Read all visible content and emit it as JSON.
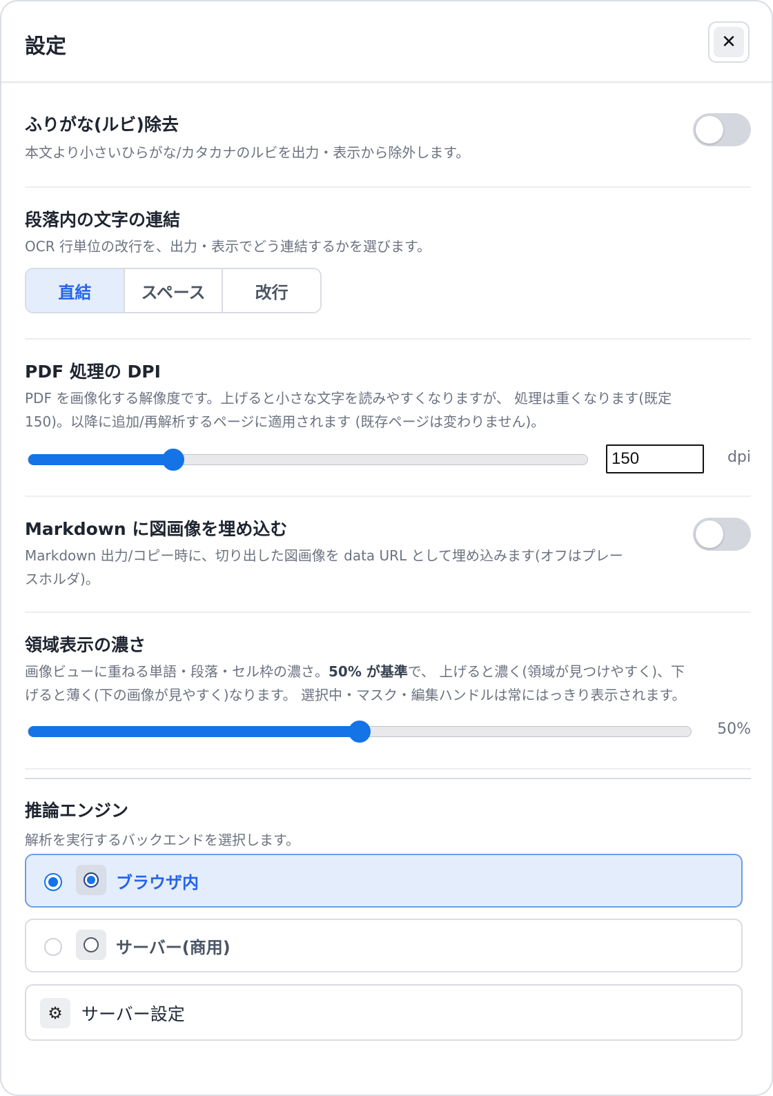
{
  "dialog": {
    "title": "設定",
    "close_glyph": "✕"
  },
  "ruby": {
    "title": "ふりがな(ルビ)除去",
    "description": "本文より小さいひらがな/カタカナのルビを出力・表示から除外します。",
    "enabled": false
  },
  "join": {
    "title": "段落内の文字の連結",
    "description": "OCR 行単位の改行を、出力・表示でどう連結するかを選びます。",
    "options": [
      "直結",
      "スペース",
      "改行"
    ],
    "selected": "直結"
  },
  "dpi": {
    "title": "PDF 処理の DPI",
    "description_line1": "PDF を画像化する解像度です。上げると小さな文字を読みやすくなりますが、 処理は重くなります(既定",
    "description_line2": "150)。以降に追加/再解析するページに適用されます (既存ページは変わりません)。",
    "value": "150",
    "unit": "dpi",
    "slider_fraction": 0.26
  },
  "markdown": {
    "title": "Markdown に図画像を埋め込む",
    "description_line1": "Markdown 出力/コピー時に、切り出した図画像を data URL として埋め込みます(オフはプレー",
    "description_line2": "スホルダ)。",
    "enabled": false
  },
  "opacity": {
    "title": "領域表示の濃さ",
    "description_pre": "画像ビューに重ねる単語・段落・セル枠の濃さ。",
    "description_bold": "50% が基準",
    "description_post": "で、 上げると濃く(領域が見つけやすく)、下",
    "description_line2": "げると薄く(下の画像が見やすく)なります。 選択中・マスク・編集ハンドルは常にはっきり表示されます。",
    "value_label": "50%",
    "slider_fraction": 0.5
  },
  "engine": {
    "title": "推論エンジン",
    "description": "解析を実行するバックエンドを選択します。",
    "options": [
      {
        "label": "ブラウザ内",
        "selected": true
      },
      {
        "label": "サーバー(商用)",
        "selected": false
      }
    ],
    "server_settings_label": "サーバー設定",
    "server_settings_icon": "gear-icon",
    "gear_glyph": "⚙"
  },
  "colors": {
    "accent": "#1473e6",
    "selected_bg": "#e4edfc",
    "selected_text": "#2563eb"
  }
}
